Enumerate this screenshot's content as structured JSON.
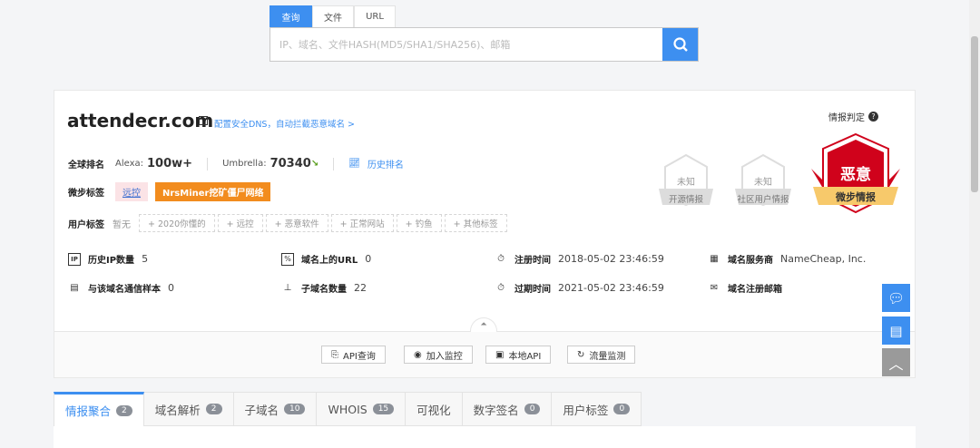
{
  "search": {
    "tabs": [
      "查询",
      "文件",
      "URL"
    ],
    "placeholder": "IP、域名、文件HASH(MD5/SHA1/SHA256)、邮箱"
  },
  "domain": {
    "name": "attendecr.com",
    "dns_link": "配置安全DNS，自动拦截恶意域名 >"
  },
  "ranking": {
    "label": "全球排名",
    "alexa_label": "Alexa:",
    "alexa_value": "100w+",
    "umbrella_label": "Umbrella:",
    "umbrella_value": "70340",
    "history": "历史排名"
  },
  "tags": {
    "label": "微步标签",
    "items": [
      "远控",
      "NrsMiner挖矿僵尸网络"
    ]
  },
  "user_tags": {
    "label": "用户标签",
    "none": "暂无",
    "items": [
      "+ 2020你懂的",
      "+ 远控",
      "+ 恶意软件",
      "+ 正常网站",
      "+ 钓鱼",
      "+ 其他标签"
    ]
  },
  "verdict": {
    "title": "情报判定",
    "open_source": {
      "value": "未知",
      "label": "开源情报"
    },
    "community": {
      "value": "未知",
      "label": "社区用户情报"
    },
    "threatbook": {
      "value": "恶意",
      "label": "微步情报"
    }
  },
  "stats": {
    "history_ip": {
      "label": "历史IP数量",
      "value": "5"
    },
    "urls": {
      "label": "域名上的URL",
      "value": "0"
    },
    "reg_time": {
      "label": "注册时间",
      "value": "2018-05-02 23:46:59"
    },
    "registrar": {
      "label": "域名服务商",
      "value": "NameCheap, Inc."
    },
    "samples": {
      "label": "与该域名通信样本",
      "value": "0"
    },
    "subdomains": {
      "label": "子域名数量",
      "value": "22"
    },
    "exp_time": {
      "label": "过期时间",
      "value": "2021-05-02 23:46:59"
    },
    "reg_email": {
      "label": "域名注册邮箱"
    }
  },
  "actions": [
    "API查询",
    "加入监控",
    "本地API",
    "流量监测"
  ],
  "tabs": [
    {
      "label": "情报聚合",
      "count": "2"
    },
    {
      "label": "域名解析",
      "count": "2"
    },
    {
      "label": "子域名",
      "count": "10"
    },
    {
      "label": "WHOIS",
      "count": "15"
    },
    {
      "label": "可视化"
    },
    {
      "label": "数字签名",
      "count": "0"
    },
    {
      "label": "用户标签",
      "count": "0"
    }
  ]
}
